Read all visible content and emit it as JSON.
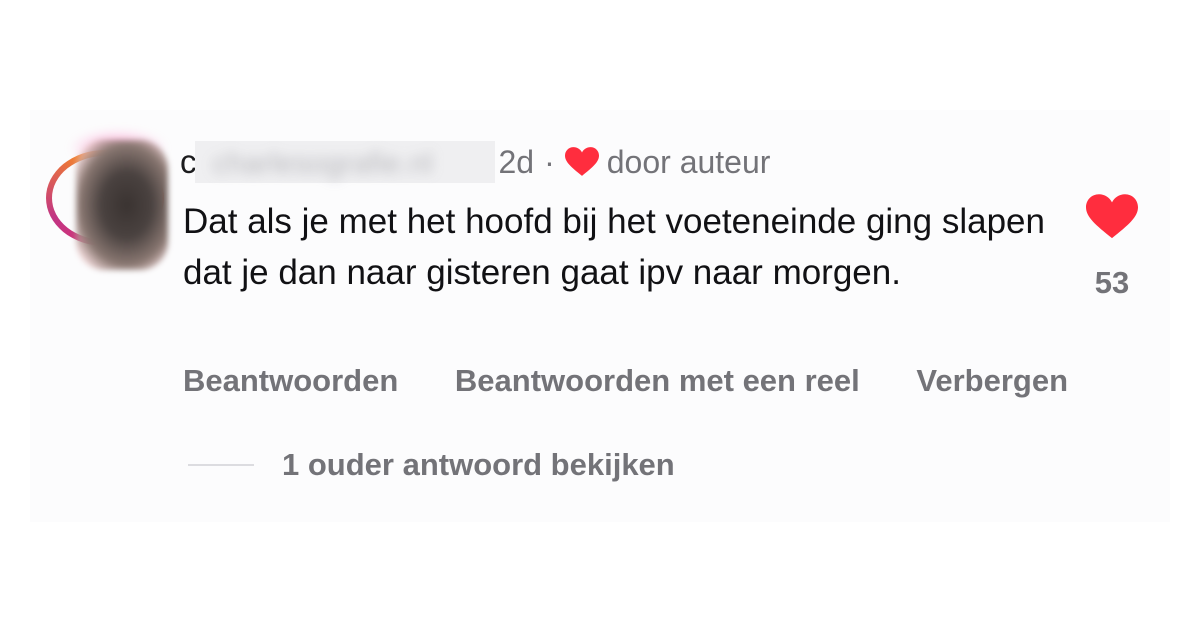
{
  "comment": {
    "username_visible_initial": "c",
    "username_blurred": "charlesografie.nl",
    "age": "2d",
    "separator": "·",
    "liked_by_author_label": "door auteur",
    "text": "Dat als je met het hoofd bij het voeteneinde ging slapen dat je dan naar gisteren gaat ipv naar morgen.",
    "like_count": "53",
    "liked": true
  },
  "actions": {
    "reply_label": "Beantwoorden",
    "reply_reel_label": "Beantwoorden met een reel",
    "hide_label": "Verbergen"
  },
  "replies": {
    "view_label": "1 ouder antwoord bekijken"
  },
  "colors": {
    "heart": "#ff2d3e",
    "muted_text": "#737378",
    "primary_text": "#111114"
  },
  "icons": {
    "author_like": "heart-icon",
    "comment_like": "heart-icon"
  }
}
